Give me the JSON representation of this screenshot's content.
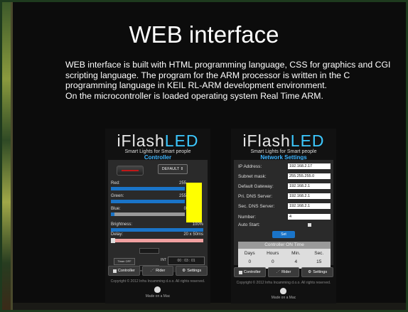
{
  "slide": {
    "title": "WEB interface",
    "paragraph1": "WEB interface is built with HTML programming language, CSS for graphics and CGI scripting language. The program for the ARM processor is written in the C programming language in KEIL RL-ARM development environment.",
    "paragraph2": "On the microcontroller is loaded operating system Real Time ARM."
  },
  "brand": {
    "logo_main": "iFlash",
    "logo_accent": "LED",
    "tagline": "Smart Lights for Smart people",
    "accent_color": "#3cc8ff"
  },
  "controller": {
    "subtitle": "Controller",
    "preset": "DEFAULT",
    "preset_icon": "updown-icon",
    "red_label": "Red:",
    "red_value": "255",
    "red_level": 1.0,
    "green_label": "Green:",
    "green_value": "255",
    "green_level": 1.0,
    "blue_label": "Blue:",
    "blue_value": "0",
    "blue_level": 0.0,
    "brightness_label": "Brightness:",
    "brightness_value": "100%",
    "brightness_level": 1.0,
    "delay_label": "Delay:",
    "delay_value": "20 x 50ms",
    "swatch_color": "#ffff00",
    "timer_label": "Timer OFF",
    "int_label": "INT",
    "int_value": "00 : 03 : 01"
  },
  "network": {
    "subtitle": "Network Settings",
    "fields": [
      {
        "label": "IP Address:",
        "value": "192.168.2.17"
      },
      {
        "label": "Subnet mask:",
        "value": "255.255.255.0"
      },
      {
        "label": "Default Gateway:",
        "value": "192.168.2.1"
      },
      {
        "label": "Pri. DNS Server:",
        "value": "192.168.2.1"
      },
      {
        "label": "Sec. DNS Server:",
        "value": "192.168.2.1"
      },
      {
        "label": "Number:",
        "value": "4"
      }
    ],
    "autostart_label": "Auto Start:",
    "set_label": "Set",
    "ontime_title": "Controller ON Time",
    "ontime_headers": [
      "Days",
      "Hours",
      "Min.",
      "Sec."
    ],
    "ontime_values": [
      "0",
      "0",
      "4",
      "15"
    ]
  },
  "nav": [
    {
      "label": "Controller",
      "icon": "list-icon"
    },
    {
      "label": "Rider",
      "icon": "rider-icon"
    },
    {
      "label": "Settings",
      "icon": "gear-icon"
    }
  ],
  "footer": {
    "copyright": "Copyright © 2012 Infra Incamming d.o.o. All rights reserved.",
    "made": "Made on a Mac"
  }
}
